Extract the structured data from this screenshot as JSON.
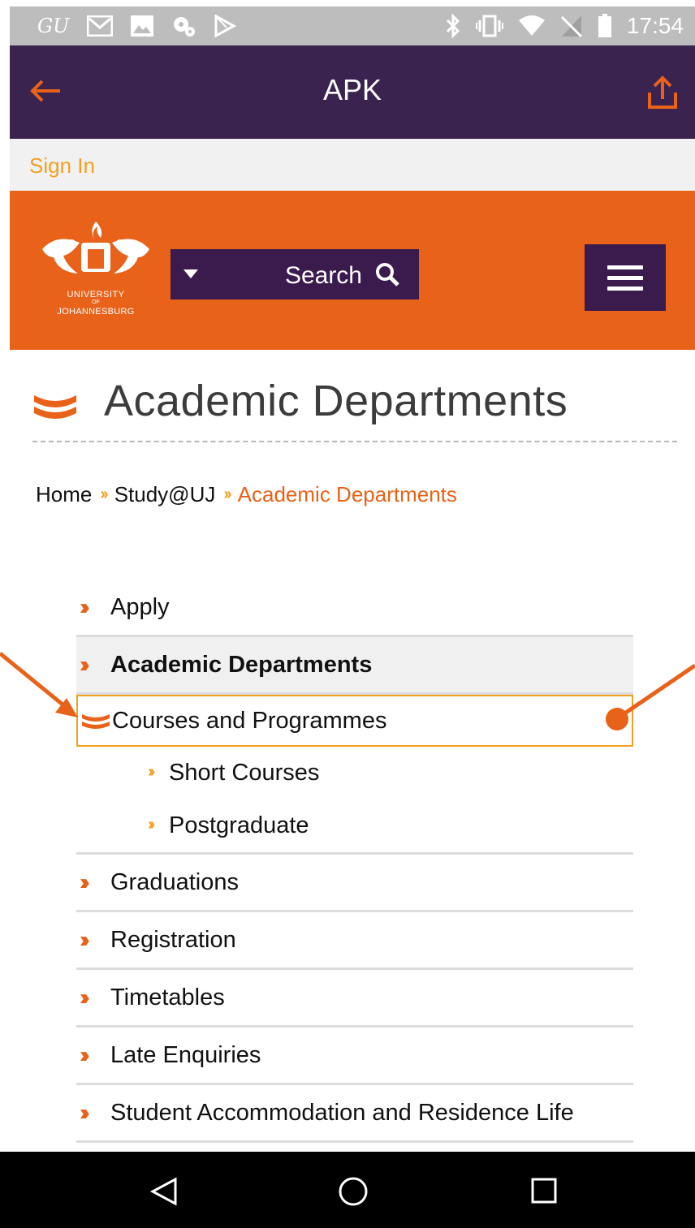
{
  "status_bar": {
    "carrier_glyph": "GU",
    "time": "17:54",
    "icons": [
      "gmail-icon",
      "image-icon",
      "settings-icon",
      "play-store-icon",
      "bluetooth-icon",
      "vibrate-icon",
      "wifi-icon",
      "no-sim-icon",
      "battery-icon"
    ]
  },
  "app_bar": {
    "title": "APK",
    "back_icon": "back-arrow-icon",
    "share_icon": "share-icon",
    "accent": "#e8621a",
    "background": "#3b2350"
  },
  "signin": {
    "label": "Sign In",
    "color": "#f2a020"
  },
  "header": {
    "logo_text_line1": "UNIVERSITY",
    "logo_text_line2": "OF",
    "logo_text_line3": "JOHANNESBURG",
    "search_label": "Search",
    "background": "#e8621a",
    "panel_color": "#3b1a4e"
  },
  "page": {
    "title": "Academic Departments"
  },
  "breadcrumb": {
    "home": "Home",
    "study": "Study@UJ",
    "current": "Academic Departments"
  },
  "nav": {
    "apply": "Apply",
    "academic_departments": "Academic Departments",
    "courses_and_programmes": "Courses and Programmes",
    "short_courses": "Short Courses",
    "postgraduate": "Postgraduate",
    "graduations": "Graduations",
    "registration": "Registration",
    "timetables": "Timetables",
    "late_enquiries": "Late Enquiries",
    "student_accommodation": "Student Accommodation and Residence Life"
  },
  "system_nav": {
    "back": "back-triangle-icon",
    "home": "home-circle-icon",
    "recents": "recents-square-icon"
  }
}
